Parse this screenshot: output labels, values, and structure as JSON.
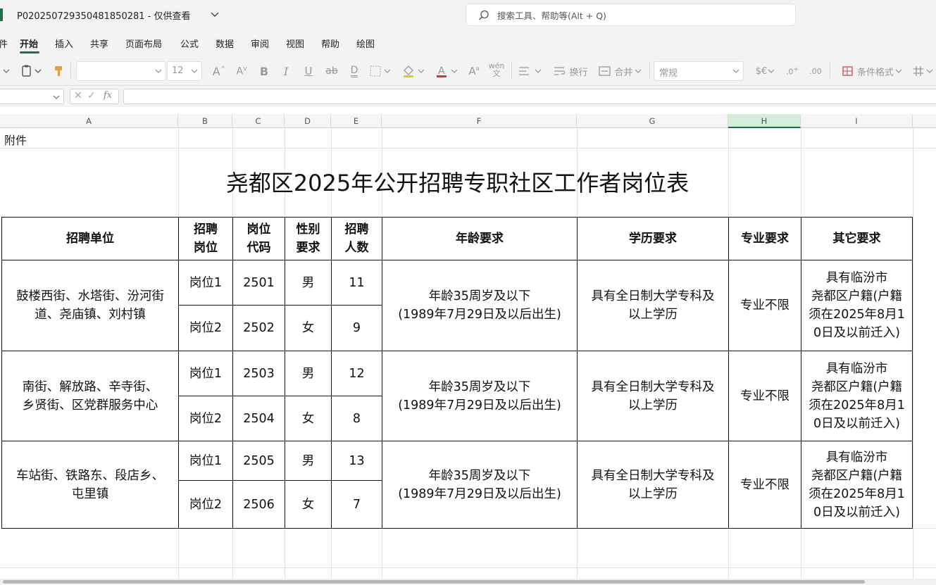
{
  "window": {
    "doc_title": "P020250729350481850281 - 仅供查看",
    "search_placeholder": "搜索工具、帮助等(Alt + Q)"
  },
  "menu": {
    "items": [
      "件",
      "开始",
      "插入",
      "共享",
      "页面布局",
      "公式",
      "数据",
      "审阅",
      "视图",
      "帮助",
      "绘图"
    ],
    "active": "开始"
  },
  "ribbon": {
    "font_size": "12",
    "wrap_label": "换行",
    "merge_label": "合并",
    "number_format": "常规",
    "cond_format_label": "条件格式",
    "currency_symbol": "$€"
  },
  "formula_bar": {
    "fx_label": "fx",
    "value": ""
  },
  "sheet": {
    "columns": [
      "A",
      "B",
      "C",
      "D",
      "E",
      "F",
      "G",
      "H",
      "I"
    ],
    "selected_column": "H",
    "fujian": "附件",
    "title": "尧都区2025年公开招聘专职社区工作者岗位表",
    "headers": {
      "unit": "招聘单位",
      "post_l1": "招聘",
      "post_l2": "岗位",
      "code_l1": "岗位",
      "code_l2": "代码",
      "gender_l1": "性别",
      "gender_l2": "要求",
      "count_l1": "招聘",
      "count_l2": "人数",
      "age": "年龄要求",
      "edu": "学历要求",
      "major": "专业要求",
      "other": "其它要求"
    },
    "groups": [
      {
        "unit_l1": "鼓楼西街、水塔街、汾河街",
        "unit_l2": "道、尧庙镇、刘村镇",
        "rows": [
          {
            "post": "岗位1",
            "code": "2501",
            "gender": "男",
            "count": "11"
          },
          {
            "post": "岗位2",
            "code": "2502",
            "gender": "女",
            "count": "9"
          }
        ],
        "age_l1": "年龄35周岁及以下",
        "age_l2": "(1989年7月29日及以后出生)",
        "edu_l1": "具有全日制大学专科及",
        "edu_l2": "以上学历",
        "major": "专业不限",
        "other_l1": "具有临汾市",
        "other_l2": "尧都区户籍(户籍",
        "other_l3": "须在2025年8月1",
        "other_l4": "0日及以前迁入)"
      },
      {
        "unit_l1": "南街、解放路、辛寺街、",
        "unit_l2": "乡贤街、区党群服务中心",
        "rows": [
          {
            "post": "岗位1",
            "code": "2503",
            "gender": "男",
            "count": "12"
          },
          {
            "post": "岗位2",
            "code": "2504",
            "gender": "女",
            "count": "8"
          }
        ],
        "age_l1": "年龄35周岁及以下",
        "age_l2": "(1989年7月29日及以后出生)",
        "edu_l1": "具有全日制大学专科及",
        "edu_l2": "以上学历",
        "major": "专业不限",
        "other_l1": "具有临汾市",
        "other_l2": "尧都区户籍(户籍",
        "other_l3": "须在2025年8月1",
        "other_l4": "0日及以前迁入)"
      },
      {
        "unit_l1": "车站街、铁路东、段店乡、",
        "unit_l2": "屯里镇",
        "rows": [
          {
            "post": "岗位1",
            "code": "2505",
            "gender": "男",
            "count": "13"
          },
          {
            "post": "岗位2",
            "code": "2506",
            "gender": "女",
            "count": "7"
          }
        ],
        "age_l1": "年龄35周岁及以下",
        "age_l2": "(1989年7月29日及以后出生)",
        "edu_l1": "具有全日制大学专科及",
        "edu_l2": "以上学历",
        "major": "专业不限",
        "other_l1": "具有临汾市",
        "other_l2": "尧都区户籍(户籍",
        "other_l3": "须在2025年8月1",
        "other_l4": "0日及以前迁入)"
      }
    ]
  }
}
